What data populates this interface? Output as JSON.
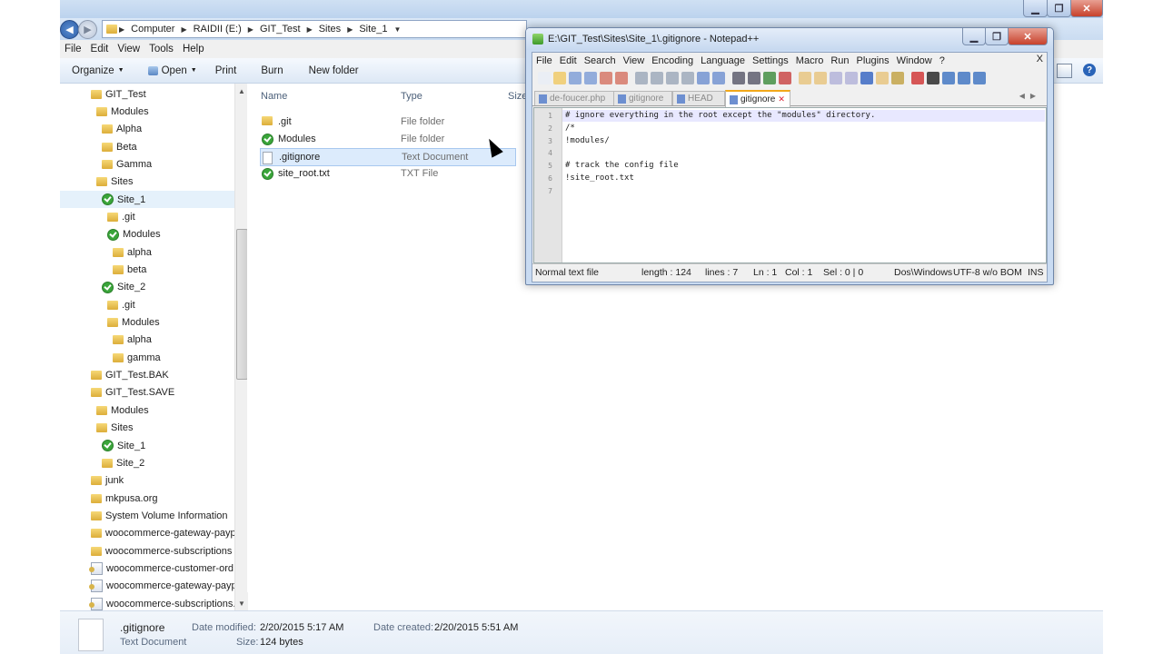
{
  "explorer": {
    "address_crumbs": [
      "Computer",
      "RAIDII (E:)",
      "GIT_Test",
      "Sites",
      "Site_1"
    ],
    "menu": [
      "File",
      "Edit",
      "View",
      "Tools",
      "Help"
    ],
    "toolbar": {
      "organize": "Organize",
      "open": "Open",
      "print": "Print",
      "burn": "Burn",
      "new_folder": "New folder"
    },
    "columns": {
      "name": "Name",
      "type": "Type",
      "size": "Size"
    },
    "tree": [
      {
        "label": "GIT_Test",
        "icon": "folder"
      },
      {
        "label": "Modules",
        "icon": "folder"
      },
      {
        "label": "Alpha",
        "icon": "folder"
      },
      {
        "label": "Beta",
        "icon": "folder"
      },
      {
        "label": "Gamma",
        "icon": "folder"
      },
      {
        "label": "Sites",
        "icon": "folder"
      },
      {
        "label": "Site_1",
        "icon": "git"
      },
      {
        "label": ".git",
        "icon": "folder"
      },
      {
        "label": "Modules",
        "icon": "git"
      },
      {
        "label": "alpha",
        "icon": "folder"
      },
      {
        "label": "beta",
        "icon": "folder"
      },
      {
        "label": "Site_2",
        "icon": "git"
      },
      {
        "label": ".git",
        "icon": "folder"
      },
      {
        "label": "Modules",
        "icon": "folder"
      },
      {
        "label": "alpha",
        "icon": "folder"
      },
      {
        "label": "gamma",
        "icon": "folder"
      },
      {
        "label": "GIT_Test.BAK",
        "icon": "folder"
      },
      {
        "label": "GIT_Test.SAVE",
        "icon": "folder"
      },
      {
        "label": "Modules",
        "icon": "folder"
      },
      {
        "label": "Sites",
        "icon": "folder"
      },
      {
        "label": "Site_1",
        "icon": "git"
      },
      {
        "label": "Site_2",
        "icon": "folder"
      },
      {
        "label": "junk",
        "icon": "folder"
      },
      {
        "label": "mkpusa.org",
        "icon": "folder"
      },
      {
        "label": "System Volume Information",
        "icon": "folder"
      },
      {
        "label": "woocommerce-gateway-payp",
        "icon": "folder"
      },
      {
        "label": "woocommerce-subscriptions",
        "icon": "folder"
      },
      {
        "label": "woocommerce-customer-ord",
        "icon": "php"
      },
      {
        "label": "woocommerce-gateway-payp",
        "icon": "php"
      },
      {
        "label": "woocommerce-subscriptions.",
        "icon": "php"
      }
    ],
    "files": [
      {
        "name": ".git",
        "type": "File folder",
        "icon": "folder"
      },
      {
        "name": "Modules",
        "type": "File folder",
        "icon": "git"
      },
      {
        "name": ".gitignore",
        "type": "Text Document",
        "icon": "doc"
      },
      {
        "name": "site_root.txt",
        "type": "TXT File",
        "icon": "git"
      }
    ],
    "details": {
      "name": ".gitignore",
      "type": "Text Document",
      "modified_label": "Date modified:",
      "modified_value": "2/20/2015 5:17 AM",
      "created_label": "Date created:",
      "created_value": "2/20/2015 5:51 AM",
      "size_label": "Size:",
      "size_value": "124 bytes"
    }
  },
  "notepad": {
    "title": "E:\\GIT_Test\\Sites\\Site_1\\.gitignore - Notepad++",
    "menu": [
      "File",
      "Edit",
      "Search",
      "View",
      "Encoding",
      "Language",
      "Settings",
      "Macro",
      "Run",
      "Plugins",
      "Window",
      "?"
    ],
    "doc_close": "X",
    "tabs": [
      "de-foucer.php",
      "gitignore",
      "HEAD",
      "gitignore"
    ],
    "lines": [
      "# ignore everything in the root except the \"modules\" directory.",
      "/*",
      "!modules/",
      "",
      "# track the config file",
      "!site_root.txt",
      ""
    ],
    "status": {
      "type": "Normal text file",
      "length": "length : 124",
      "lines": "lines : 7",
      "ln": "Ln : 1",
      "col": "Col : 1",
      "sel": "Sel : 0 | 0",
      "format": "Dos\\Windows",
      "encoding": "UTF-8 w/o BOM",
      "mode": "INS"
    }
  }
}
